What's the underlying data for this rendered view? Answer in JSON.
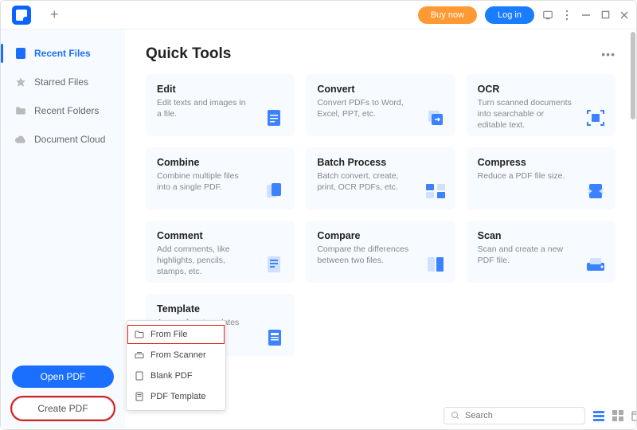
{
  "titlebar": {
    "buy": "Buy now",
    "login": "Log in"
  },
  "sidebar": {
    "items": [
      {
        "label": "Recent Files"
      },
      {
        "label": "Starred Files"
      },
      {
        "label": "Recent Folders"
      },
      {
        "label": "Document Cloud"
      }
    ],
    "open": "Open PDF",
    "create": "Create PDF"
  },
  "main": {
    "title": "Quick Tools",
    "cards": [
      {
        "title": "Edit",
        "desc": "Edit texts and images in a file."
      },
      {
        "title": "Convert",
        "desc": "Convert PDFs to Word, Excel, PPT, etc."
      },
      {
        "title": "OCR",
        "desc": "Turn scanned documents into searchable or editable text."
      },
      {
        "title": "Combine",
        "desc": "Combine multiple files into a single PDF."
      },
      {
        "title": "Batch Process",
        "desc": "Batch convert, create, print, OCR PDFs, etc."
      },
      {
        "title": "Compress",
        "desc": "Reduce a PDF file size."
      },
      {
        "title": "Comment",
        "desc": "Add comments, like highlights, pencils, stamps, etc."
      },
      {
        "title": "Compare",
        "desc": "Compare the differences between two files."
      },
      {
        "title": "Scan",
        "desc": "Scan and create a new PDF file."
      },
      {
        "title": "Template",
        "desc": "Access free templates like calendars, etc."
      }
    ]
  },
  "popup": {
    "items": [
      {
        "label": "From File"
      },
      {
        "label": "From Scanner"
      },
      {
        "label": "Blank PDF"
      },
      {
        "label": "PDF Template"
      }
    ]
  },
  "footer": {
    "search_placeholder": "Search"
  }
}
